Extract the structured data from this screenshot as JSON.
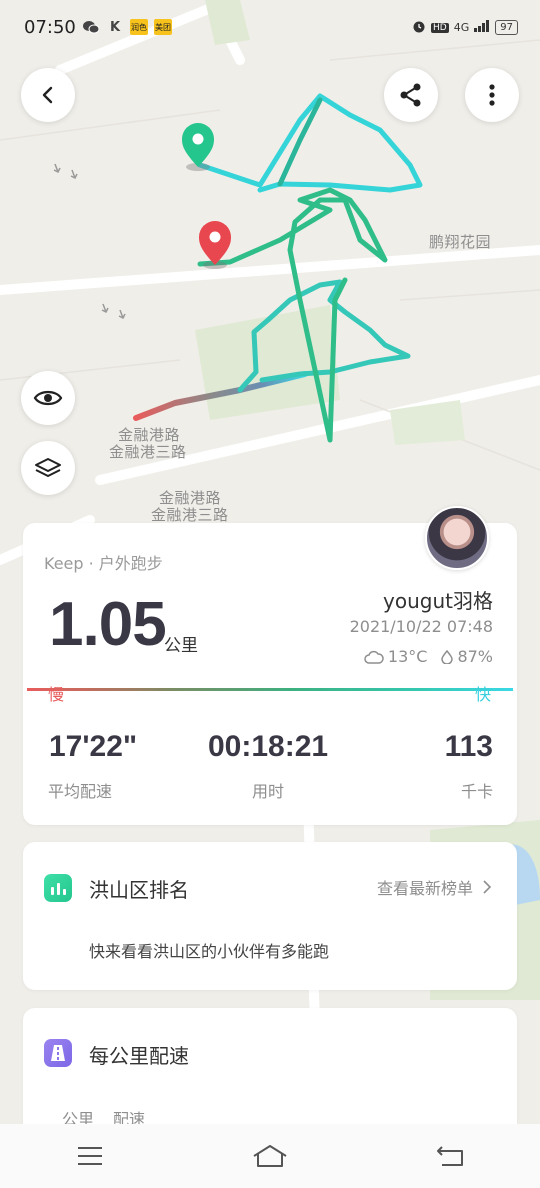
{
  "status_bar": {
    "time": "07:50",
    "icons_left": [
      "wechat-icon",
      "k-icon",
      "app-icon",
      "meituan-icon"
    ],
    "app_badge_1": "润色",
    "app_badge_2": "美团",
    "network": "4G",
    "battery": "97"
  },
  "map": {
    "labels": [
      "鹏翔花园",
      "金融港路",
      "金融港三路",
      "金融港路",
      "金融港三路"
    ],
    "colors": {
      "route_fast": "#3ad9e6",
      "route_mid": "#2fbd8a",
      "route_slow": "#e85c5c",
      "park": "#dfe9d3"
    }
  },
  "summary": {
    "source": "Keep · 户外跑步",
    "distance": "1.05",
    "distance_unit": "公里",
    "user": "yougut羽格",
    "datetime": "2021/10/22 07:48",
    "temperature": "13°C",
    "humidity": "87%",
    "slow_label": "慢",
    "fast_label": "快",
    "stats": [
      {
        "value": "17'22\"",
        "label": "平均配速"
      },
      {
        "value": "00:18:21",
        "label": "用时"
      },
      {
        "value": "113",
        "label": "千卡"
      }
    ]
  },
  "ranking": {
    "title": "洪山区排名",
    "link": "查看最新榜单",
    "description": "快来看看洪山区的小伙伴有多能跑"
  },
  "pace_section": {
    "title": "每公里配速",
    "columns": [
      "公里",
      "配速"
    ]
  }
}
